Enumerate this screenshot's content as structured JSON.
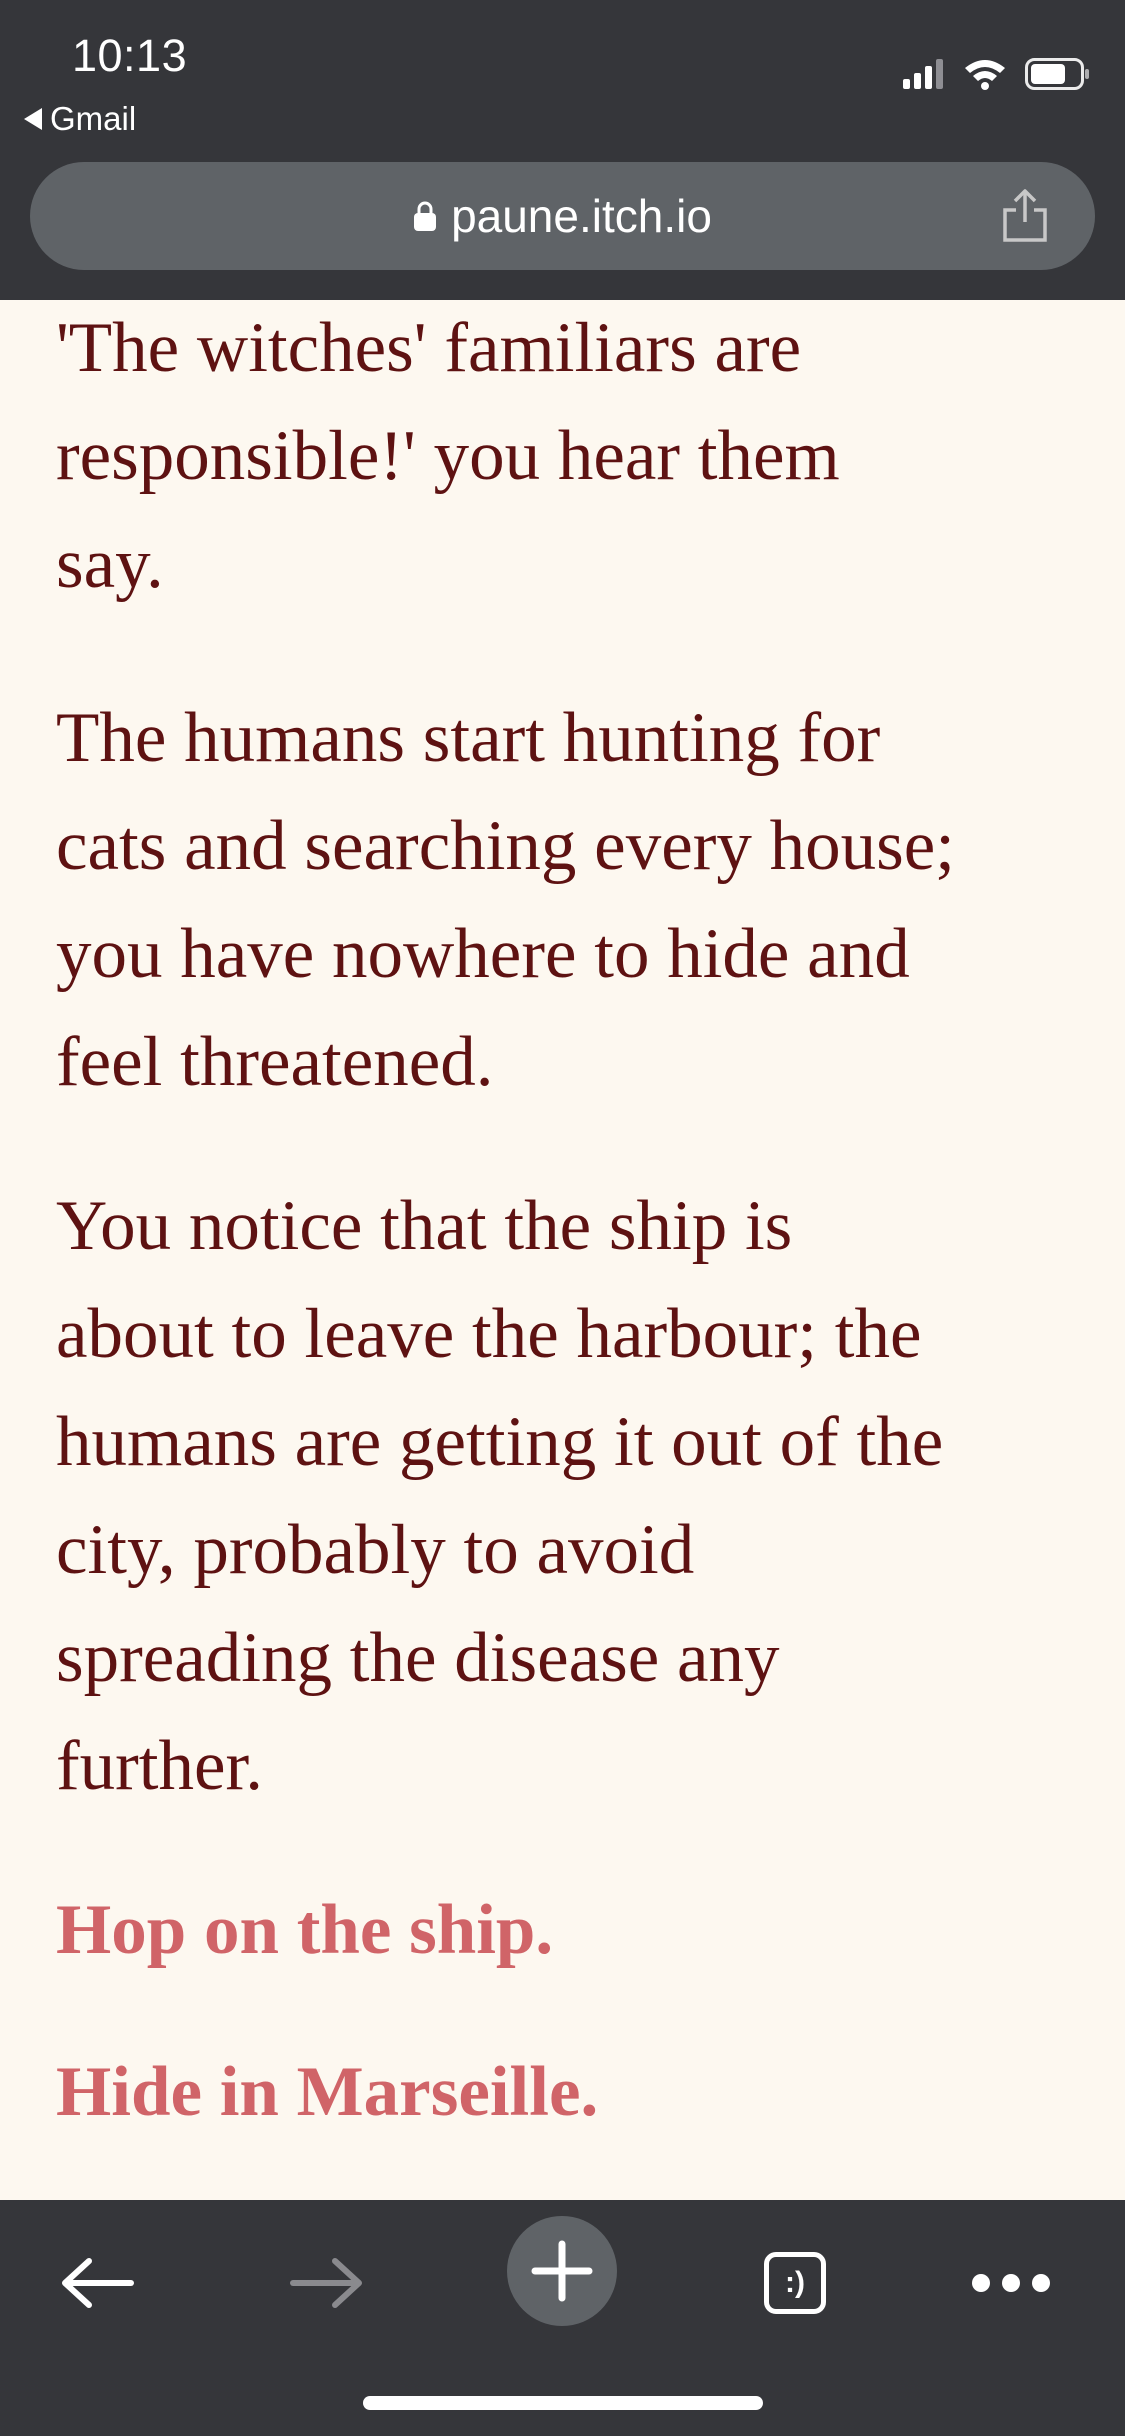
{
  "status_bar": {
    "time": "10:13",
    "back_app_label": "Gmail"
  },
  "browser": {
    "url": "paune.itch.io"
  },
  "story": {
    "paragraph_1": "'The witches' familiars are\nresponsible!' you hear them\nsay.",
    "paragraph_2": "The humans start hunting for\ncats and searching every house;\nyou have nowhere to hide and\nfeel threatened.",
    "paragraph_3": "You notice that the ship is\nabout to leave the harbour; the\nhumans are getting it out of the\ncity, probably to avoid\nspreading the disease any\nfurther.",
    "choices": [
      "Hop on the ship.",
      "Hide in Marseille."
    ]
  },
  "toolbar": {
    "tabs_icon_label": ":)"
  },
  "colors": {
    "chrome_bg": "#35363a",
    "page_bg": "#fdf8f0",
    "text": "#5e1212",
    "link": "#d06468"
  },
  "icons": [
    "signal-icon",
    "wifi-icon",
    "battery-icon",
    "lock-icon",
    "share-icon",
    "back-arrow-icon",
    "forward-arrow-icon",
    "new-tab-icon",
    "tabs-icon",
    "more-icon"
  ]
}
